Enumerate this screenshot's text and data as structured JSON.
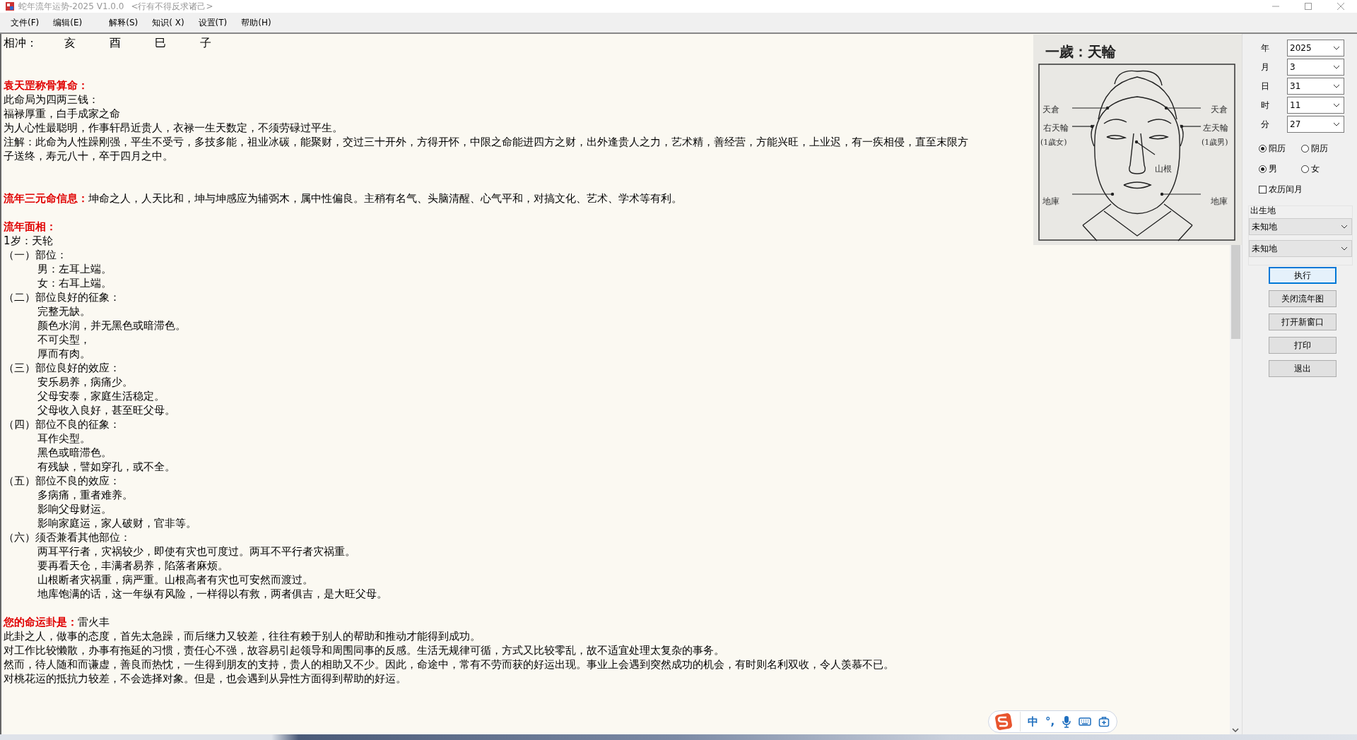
{
  "window": {
    "title": "蛇年流年运势-2025 V1.0.0",
    "subtitle": "<行有不得反求诸己>"
  },
  "menu": [
    "文件(F)",
    "编辑(E)",
    "解释(S)",
    "知识( X)",
    "设置(T)",
    "帮助(H)"
  ],
  "document": {
    "conflict": {
      "label": "相冲：",
      "branches": [
        "亥",
        "酉",
        "巳",
        "子"
      ]
    },
    "sections": [
      {
        "heading": "袁天罡称骨算命：",
        "lines": [
          {
            "text": "此命局为四两三钱："
          },
          {
            "text": "福禄厚重，白手成家之命"
          },
          {
            "text": "为人心性最聪明，作事轩昂近贵人，衣禄一生天数定，不须劳碌过平生。"
          },
          {
            "text": "注解：此命为人性躁刚强，平生不受亏，多技多能，祖业冰碳，能聚财，交过三十开外，方得开怀，中限之命能进四方之财，出外逢贵人之力，艺术精，善经营，方能兴旺，上业迟，有一疾相侵，直至末限方"
          },
          {
            "text": "子送终，寿元八十，卒于四月之中。"
          }
        ]
      },
      {
        "heading": "流年三元命信息：",
        "inline": "坤命之人，人天比和，坤与坤感应为辅弼木，属中性偏良。主稍有名气、头脑清醒、心气平和，对搞文化、艺术、学术等有利。"
      },
      {
        "heading": "流年面相：",
        "lines": [
          {
            "text": "1岁：天轮"
          },
          {
            "text": "（一）部位：",
            "children": [
              {
                "text": "男：左耳上端。"
              },
              {
                "text": "女：右耳上端。"
              }
            ]
          },
          {
            "text": "（二）部位良好的征象：",
            "children": [
              {
                "text": "完整无缺。"
              },
              {
                "text": "颜色水润，并无黑色或暗滞色。"
              },
              {
                "text": "不可尖型，"
              },
              {
                "text": "厚而有肉。"
              }
            ]
          },
          {
            "text": "（三）部位良好的效应：",
            "children": [
              {
                "text": "安乐易养，病痛少。"
              },
              {
                "text": "父母安泰，家庭生活稳定。"
              },
              {
                "text": "父母收入良好，甚至旺父母。"
              }
            ]
          },
          {
            "text": "（四）部位不良的征象：",
            "children": [
              {
                "text": "耳作尖型。"
              },
              {
                "text": "黑色或暗滞色。"
              },
              {
                "text": "有残缺，譬如穿孔，或不全。"
              }
            ]
          },
          {
            "text": "（五）部位不良的效应：",
            "children": [
              {
                "text": "多病痛，重者难养。"
              },
              {
                "text": "影响父母财运。"
              },
              {
                "text": "影响家庭运，家人破财，官非等。"
              }
            ]
          },
          {
            "text": "（六）须否兼看其他部位：",
            "children": [
              {
                "text": "两耳平行者，灾祸较少，即使有灾也可度过。两耳不平行者灾祸重。"
              },
              {
                "text": "要再看天仓，丰满者易养，陷落者麻烦。"
              },
              {
                "text": "山根断者灾祸重，病严重。山根高者有灾也可安然而渡过。"
              },
              {
                "text": "地库饱满的话，这一年纵有风险，一样得以有救，两者俱吉，是大旺父母。"
              }
            ]
          }
        ]
      },
      {
        "heading": "您的命运卦是：",
        "inline": "雷火丰",
        "lines": [
          {
            "text": "此卦之人，做事的态度，首先太急躁，而后继力又较差，往往有赖于别人的帮助和推动才能得到成功。"
          },
          {
            "text": "对工作比较懒散，办事有拖延的习惯，责任心不强，故容易引起领导和周围同事的反感。生活无规律可循，方式又比较零乱，故不适宜处理太复杂的事务。"
          },
          {
            "text": "然而，待人随和而谦虚，善良而热忱，一生得到朋友的支持，贵人的相助又不少。因此，命途中，常有不劳而获的好运出现。事业上会遇到突然成功的机会，有时则名利双收，令人羡慕不已。"
          },
          {
            "text": "对桃花运的抵抗力较差，不会选择对象。但是，也会遇到从异性方面得到帮助的好运。"
          }
        ]
      }
    ]
  },
  "face_chart": {
    "title": "一歲：天輪",
    "labels": [
      "天倉",
      "天倉",
      "右天輪",
      "(1歲女)",
      "左天輪",
      "(1歲男)",
      "山根",
      "地庫",
      "地庫"
    ]
  },
  "settings": {
    "fields": [
      {
        "label": "年",
        "value": "2025"
      },
      {
        "label": "月",
        "value": "3"
      },
      {
        "label": "日",
        "value": "31"
      },
      {
        "label": "时",
        "value": "11"
      },
      {
        "label": "分",
        "value": "27"
      }
    ],
    "calendar": [
      {
        "label": "阳历",
        "selected": true
      },
      {
        "label": "阴历",
        "selected": false
      }
    ],
    "gender": [
      {
        "label": "男",
        "selected": true
      },
      {
        "label": "女",
        "selected": false
      }
    ],
    "leap_month": {
      "label": "农历闰月",
      "checked": false
    },
    "birthplace": {
      "label": "出生地",
      "selects": [
        "未知地",
        "未知地"
      ]
    },
    "buttons": [
      {
        "label": "执行",
        "default": true
      },
      {
        "label": "关闭流年图",
        "default": false
      },
      {
        "label": "打开新窗口",
        "default": false
      },
      {
        "label": "打印",
        "default": false
      },
      {
        "label": "退出",
        "default": false
      }
    ]
  },
  "ime_bar": {
    "mode": "中",
    "punctuation": "°,"
  }
}
